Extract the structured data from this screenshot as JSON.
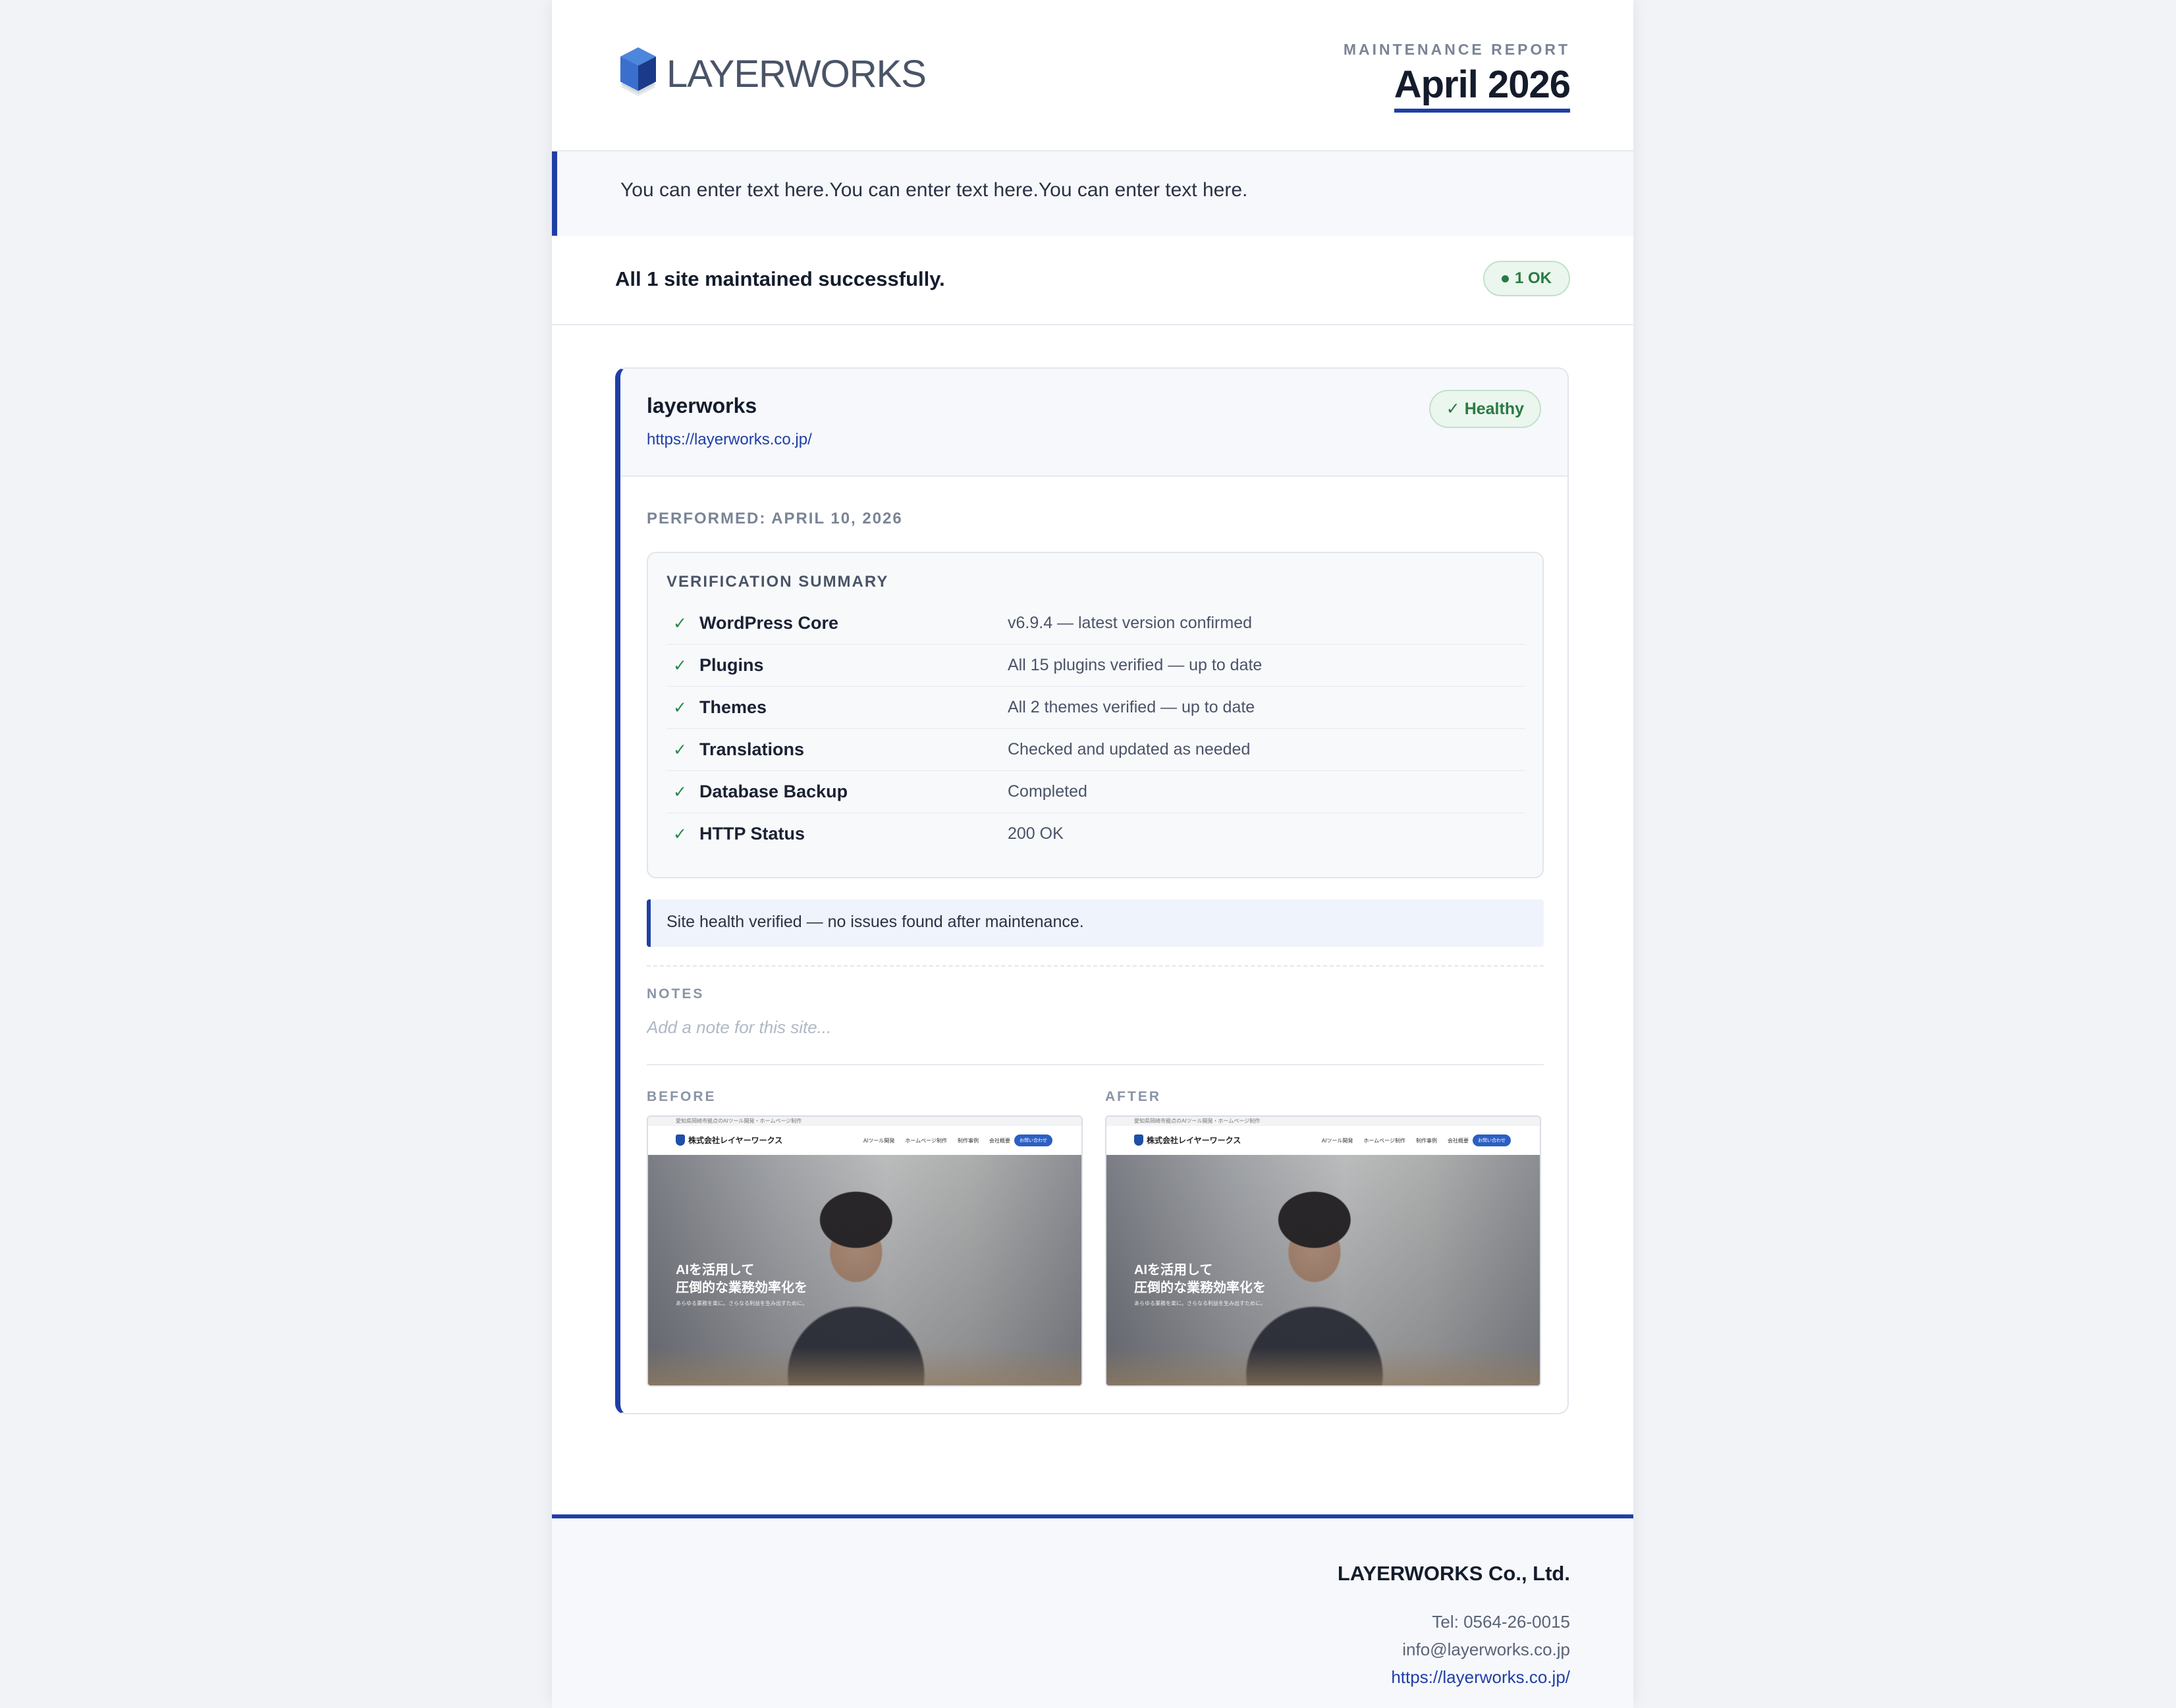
{
  "header": {
    "logo_text": "LAYERWORKS",
    "report_label": "MAINTENANCE REPORT",
    "report_month": "April 2026"
  },
  "intro": {
    "text": "You can enter text here.You can enter text here.You can enter text here."
  },
  "summary": {
    "text": "All 1 site maintained successfully.",
    "ok_badge": "1 OK"
  },
  "site": {
    "name": "layerworks",
    "url": "https://layerworks.co.jp/",
    "status_badge": "✓ Healthy",
    "performed": "PERFORMED: APRIL 10, 2026",
    "verification": {
      "title": "VERIFICATION SUMMARY",
      "rows": [
        {
          "label": "WordPress Core",
          "value": "v6.9.4 — latest version confirmed"
        },
        {
          "label": "Plugins",
          "value": "All 15 plugins verified — up to date"
        },
        {
          "label": "Themes",
          "value": "All 2 themes verified — up to date"
        },
        {
          "label": "Translations",
          "value": "Checked and updated as needed"
        },
        {
          "label": "Database Backup",
          "value": "Completed"
        },
        {
          "label": "HTTP Status",
          "value": "200 OK"
        }
      ]
    },
    "health_note": "Site health verified — no issues found after maintenance.",
    "notes": {
      "label": "NOTES",
      "placeholder": "Add a note for this site..."
    },
    "screenshots": {
      "before_label": "BEFORE",
      "after_label": "AFTER",
      "preview": {
        "top_text": "愛知県岡崎市拠点のAIツール開発・ホームページ制作",
        "brand": "株式会社レイヤーワークス",
        "nav": [
          "AIツール開発",
          "ホームページ制作",
          "制作事例",
          "会社概要"
        ],
        "cta": "お問い合わせ",
        "headline": "AIを活用して\n圧倒的な業務効率化を",
        "subline": "あらゆる業務を楽に。さらなる利益を生み出すために。"
      }
    }
  },
  "footer": {
    "company": "LAYERWORKS Co., Ltd.",
    "tel": "Tel: 0564-26-0015",
    "email": "info@layerworks.co.jp",
    "url": "https://layerworks.co.jp/"
  },
  "colors": {
    "accent": "#1f3fa6",
    "ok_green": "#2a7a43",
    "background": "#f1f3f6"
  }
}
